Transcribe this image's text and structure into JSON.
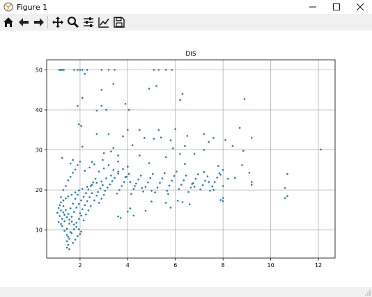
{
  "window": {
    "title": "Figure 1"
  },
  "toolbar": {
    "icons": [
      "home-icon",
      "back-arrow-icon",
      "forward-arrow-icon",
      "pan-icon",
      "zoom-icon",
      "configure-subplots-icon",
      "edit-axes-icon",
      "save-icon"
    ]
  },
  "chart_data": {
    "type": "scatter",
    "title": "DIS",
    "xlabel": "",
    "ylabel": "",
    "xlim": [
      0.6,
      12.7
    ],
    "ylim": [
      3,
      52.5
    ],
    "xticks": [
      2,
      4,
      6,
      8,
      10,
      12
    ],
    "yticks": [
      10,
      20,
      30,
      40,
      50
    ],
    "grid": true,
    "color": "#1f77b4",
    "points": [
      [
        1.13,
        50
      ],
      [
        1.17,
        50
      ],
      [
        1.2,
        50
      ],
      [
        1.25,
        50
      ],
      [
        1.32,
        50
      ],
      [
        1.75,
        50
      ],
      [
        1.9,
        50
      ],
      [
        2.0,
        50
      ],
      [
        2.1,
        50
      ],
      [
        2.3,
        50
      ],
      [
        2.9,
        50
      ],
      [
        3.2,
        50
      ],
      [
        3.45,
        50
      ],
      [
        5.1,
        50
      ],
      [
        5.3,
        50
      ],
      [
        5.6,
        50
      ],
      [
        5.85,
        50
      ],
      [
        2.2,
        49
      ],
      [
        3.4,
        46.5
      ],
      [
        2.9,
        45
      ],
      [
        4.9,
        45.3
      ],
      [
        5.2,
        46
      ],
      [
        6.3,
        44
      ],
      [
        2.1,
        43
      ],
      [
        6.2,
        42.5
      ],
      [
        8.9,
        42.7
      ],
      [
        3.9,
        41.5
      ],
      [
        2.9,
        41
      ],
      [
        1.9,
        41
      ],
      [
        4.05,
        40
      ],
      [
        3.1,
        40
      ],
      [
        2.7,
        39.8
      ],
      [
        2.05,
        36
      ],
      [
        1.95,
        36.4
      ],
      [
        4.0,
        35
      ],
      [
        4.5,
        35
      ],
      [
        5.3,
        35
      ],
      [
        6.0,
        35.2
      ],
      [
        8.7,
        35.5
      ],
      [
        2.7,
        34
      ],
      [
        3.2,
        34
      ],
      [
        3.8,
        33.4
      ],
      [
        4.7,
        33
      ],
      [
        5.1,
        32.8
      ],
      [
        5.4,
        33.1
      ],
      [
        5.8,
        32.4
      ],
      [
        6.5,
        33.5
      ],
      [
        7.6,
        33
      ],
      [
        8.1,
        32.5
      ],
      [
        9.2,
        33
      ],
      [
        7.2,
        34
      ],
      [
        7.4,
        32
      ],
      [
        6.8,
        29
      ],
      [
        7.2,
        30
      ],
      [
        5.9,
        30.4
      ],
      [
        6.4,
        31
      ],
      [
        8.4,
        31
      ],
      [
        4.2,
        31.2
      ],
      [
        3.4,
        30.5
      ],
      [
        2.1,
        30.8
      ],
      [
        3.0,
        29.2
      ],
      [
        3.3,
        29.6
      ],
      [
        3.6,
        28.6
      ],
      [
        4.5,
        28.6
      ],
      [
        5.6,
        28.2
      ],
      [
        6.2,
        29
      ],
      [
        2.95,
        27.5
      ],
      [
        2.5,
        27
      ],
      [
        1.25,
        28
      ],
      [
        1.7,
        27.5
      ],
      [
        1.6,
        26.6
      ],
      [
        3.6,
        27.1
      ],
      [
        4.9,
        26.7
      ],
      [
        6.4,
        26.5
      ],
      [
        7.8,
        26
      ],
      [
        8.8,
        26.2
      ],
      [
        8.85,
        29.8
      ],
      [
        9.1,
        24.3
      ],
      [
        9.2,
        22
      ],
      [
        9.2,
        21.3
      ],
      [
        10.7,
        24
      ],
      [
        10.6,
        20.5
      ],
      [
        10.7,
        18.5
      ],
      [
        10.6,
        18
      ],
      [
        12.1,
        30.1
      ],
      [
        8.5,
        23
      ],
      [
        8.2,
        22.8
      ],
      [
        8.0,
        25
      ],
      [
        7.2,
        24.5
      ],
      [
        7.9,
        23.8
      ],
      [
        7.4,
        22
      ],
      [
        6.7,
        21.5
      ],
      [
        6.8,
        20.8
      ],
      [
        7.6,
        20
      ],
      [
        8.0,
        21
      ],
      [
        8.0,
        18
      ],
      [
        8.0,
        17.2
      ],
      [
        7.9,
        17.5
      ],
      [
        6.1,
        17.3
      ],
      [
        5.6,
        16.8
      ],
      [
        5.0,
        17.1
      ],
      [
        4.1,
        15.4
      ],
      [
        4.0,
        14.6
      ],
      [
        3.7,
        13
      ],
      [
        3.6,
        13.4
      ],
      [
        4.25,
        13.6
      ],
      [
        4.75,
        14.8
      ],
      [
        5.8,
        15.6
      ],
      [
        6.6,
        16.4
      ],
      [
        6.3,
        17
      ],
      [
        5.7,
        19
      ],
      [
        5.0,
        19.8
      ],
      [
        4.6,
        20.5
      ],
      [
        4.3,
        21
      ],
      [
        4.1,
        22
      ],
      [
        3.9,
        23.2
      ],
      [
        3.6,
        24.1
      ],
      [
        3.3,
        23.6
      ],
      [
        3.1,
        22.9
      ],
      [
        2.9,
        22.1
      ],
      [
        2.7,
        21.8
      ],
      [
        2.5,
        21.3
      ],
      [
        2.3,
        20.8
      ],
      [
        2.1,
        20.3
      ],
      [
        1.95,
        19.9
      ],
      [
        1.8,
        19.4
      ],
      [
        1.65,
        18.8
      ],
      [
        1.5,
        18.4
      ],
      [
        1.4,
        17.9
      ],
      [
        1.3,
        17.4
      ],
      [
        1.2,
        16.9
      ],
      [
        1.15,
        16.2
      ],
      [
        1.1,
        15.5
      ],
      [
        1.2,
        14.9
      ],
      [
        1.3,
        14.4
      ],
      [
        1.35,
        13.8
      ],
      [
        1.45,
        13.2
      ],
      [
        1.55,
        12.6
      ],
      [
        1.65,
        12.1
      ],
      [
        1.75,
        11.4
      ],
      [
        1.85,
        10.8
      ],
      [
        1.95,
        10.2
      ],
      [
        2.05,
        9.6
      ],
      [
        1.6,
        9.5
      ],
      [
        1.5,
        8.3
      ],
      [
        1.45,
        7.2
      ],
      [
        1.5,
        6.3
      ],
      [
        1.45,
        5.6
      ],
      [
        1.55,
        5.2
      ],
      [
        1.7,
        6.8
      ],
      [
        1.8,
        7.6
      ],
      [
        1.9,
        8.5
      ],
      [
        2.0,
        9.0
      ],
      [
        1.25,
        11
      ],
      [
        1.35,
        12.2
      ],
      [
        1.45,
        10.3
      ],
      [
        1.55,
        11.6
      ],
      [
        1.65,
        13.3
      ],
      [
        1.75,
        14.5
      ],
      [
        1.85,
        15.6
      ],
      [
        1.95,
        16.5
      ],
      [
        2.05,
        17.4
      ],
      [
        2.15,
        18.3
      ],
      [
        2.25,
        19.2
      ],
      [
        2.35,
        20.1
      ],
      [
        2.45,
        21
      ],
      [
        2.55,
        21.9
      ],
      [
        2.65,
        22.8
      ],
      [
        2.75,
        19.5
      ],
      [
        2.85,
        20.4
      ],
      [
        2.95,
        21.2
      ],
      [
        3.05,
        19.8
      ],
      [
        3.15,
        20.6
      ],
      [
        3.25,
        21.4
      ],
      [
        3.35,
        22.2
      ],
      [
        3.45,
        23
      ],
      [
        3.55,
        19.1
      ],
      [
        3.65,
        20
      ],
      [
        3.75,
        21
      ],
      [
        3.85,
        22
      ],
      [
        3.95,
        23.3
      ],
      [
        4.05,
        24
      ],
      [
        4.15,
        19
      ],
      [
        4.25,
        20.2
      ],
      [
        4.35,
        21.6
      ],
      [
        4.45,
        22.6
      ],
      [
        4.55,
        23.6
      ],
      [
        4.65,
        19.6
      ],
      [
        4.75,
        20.8
      ],
      [
        4.85,
        21.9
      ],
      [
        4.95,
        23
      ],
      [
        5.05,
        24
      ],
      [
        5.15,
        19.4
      ],
      [
        5.25,
        20.6
      ],
      [
        5.35,
        21.8
      ],
      [
        5.45,
        22.9
      ],
      [
        5.55,
        24.2
      ],
      [
        5.65,
        19.8
      ],
      [
        5.75,
        21.1
      ],
      [
        5.85,
        22.3
      ],
      [
        5.95,
        23.5
      ],
      [
        6.05,
        24.6
      ],
      [
        6.15,
        20.2
      ],
      [
        6.25,
        21.3
      ],
      [
        6.35,
        22.4
      ],
      [
        6.45,
        23.6
      ],
      [
        6.55,
        19.5
      ],
      [
        6.65,
        20.6
      ],
      [
        6.75,
        21.7
      ],
      [
        6.85,
        22.8
      ],
      [
        6.95,
        23.9
      ],
      [
        7.05,
        20.1
      ],
      [
        7.15,
        21.2
      ],
      [
        7.25,
        22.3
      ],
      [
        7.35,
        23.4
      ],
      [
        7.45,
        19.8
      ],
      [
        7.55,
        20.9
      ],
      [
        7.65,
        22
      ],
      [
        7.75,
        23.1
      ],
      [
        7.85,
        24.2
      ],
      [
        1.3,
        20
      ],
      [
        1.4,
        21
      ],
      [
        1.5,
        22.4
      ],
      [
        1.6,
        23.3
      ],
      [
        1.7,
        24.3
      ],
      [
        1.8,
        25.1
      ],
      [
        1.9,
        26.2
      ],
      [
        2.0,
        27.1
      ],
      [
        2.2,
        24.8
      ],
      [
        2.4,
        25.6
      ],
      [
        2.6,
        26.4
      ],
      [
        2.8,
        24.6
      ],
      [
        3.0,
        25.4
      ],
      [
        3.2,
        26.2
      ],
      [
        3.4,
        25
      ],
      [
        3.6,
        24.6
      ],
      [
        3.8,
        25.2
      ],
      [
        4.0,
        25.8
      ],
      [
        1.2,
        18.2
      ],
      [
        1.3,
        16
      ],
      [
        1.4,
        15
      ],
      [
        1.5,
        14
      ],
      [
        1.6,
        15.4
      ],
      [
        1.7,
        16.6
      ],
      [
        1.8,
        17.8
      ],
      [
        1.9,
        18.8
      ],
      [
        2.0,
        14.2
      ],
      [
        2.1,
        15.2
      ],
      [
        2.2,
        16.2
      ],
      [
        2.3,
        17.2
      ],
      [
        2.4,
        18.2
      ],
      [
        2.5,
        19.2
      ],
      [
        2.6,
        17.4
      ],
      [
        2.7,
        18.6
      ],
      [
        2.8,
        16.8
      ],
      [
        2.9,
        17.8
      ],
      [
        3.0,
        18.8
      ],
      [
        1.25,
        12.8
      ],
      [
        1.35,
        9.8
      ],
      [
        1.45,
        8.8
      ],
      [
        1.55,
        7.8
      ],
      [
        1.65,
        9.2
      ],
      [
        1.75,
        10.2
      ],
      [
        1.85,
        11.8
      ],
      [
        1.95,
        12.8
      ],
      [
        2.05,
        13.6
      ],
      [
        2.15,
        12.4
      ],
      [
        2.25,
        13.9
      ],
      [
        2.35,
        14.9
      ],
      [
        2.45,
        16
      ],
      [
        1.15,
        13.5
      ],
      [
        1.05,
        14.3
      ],
      [
        1.1,
        12
      ],
      [
        1.2,
        11.5
      ]
    ]
  }
}
